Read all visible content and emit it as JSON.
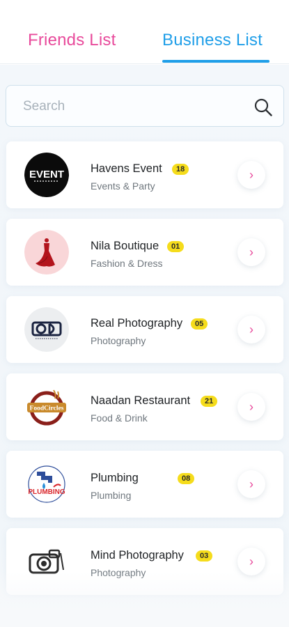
{
  "tabs": {
    "friends": "Friends List",
    "business": "Business List",
    "active": "business"
  },
  "search": {
    "placeholder": "Search"
  },
  "colors": {
    "pink": "#e84a9b",
    "blue": "#1f9ee8",
    "badge": "#f5dc1c"
  },
  "businesses": [
    {
      "name": "Havens Event",
      "count": "18",
      "category": "Events & Party",
      "logo_icon": "event-logo-icon"
    },
    {
      "name": "Nila Boutique",
      "count": "01",
      "category": "Fashion & Dress",
      "logo_icon": "dress-logo-icon"
    },
    {
      "name": "Real Photography",
      "count": "05",
      "category": "Photography",
      "logo_icon": "camera-logo-icon"
    },
    {
      "name": "Naadan Restaurant",
      "count": "21",
      "category": "Food & Drink",
      "logo_icon": "foodcircles-logo-icon"
    },
    {
      "name": "Plumbing",
      "count": "08",
      "category": "Plumbing",
      "logo_icon": "plumbing-logo-icon"
    },
    {
      "name": "Mind Photography",
      "count": "03",
      "category": "Photography",
      "logo_icon": "camera-sketch-logo-icon"
    }
  ],
  "logo_text": {
    "event_word": "EVENT",
    "foodcircles_word": "FoodCircles",
    "plumbing_word": "PLUMBING"
  }
}
